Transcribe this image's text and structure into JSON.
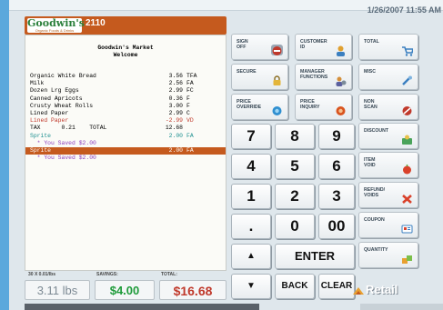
{
  "header": {
    "logo_text": "Goodwin's",
    "logo_sub": "Organic Foods & Drinks",
    "store_number": "2110",
    "datetime": "1/26/2007 11:55 AM"
  },
  "receipt": {
    "store_name": "Goodwin's Market",
    "welcome": "Welcome",
    "lines": [
      {
        "name": "Organic White Bread",
        "amount": "3.56",
        "code": "TFA",
        "style": ""
      },
      {
        "name": "Milk",
        "amount": "2.56",
        "code": "FA",
        "style": ""
      },
      {
        "name": "Dozen Lrg Eggs",
        "amount": "2.99",
        "code": "FC",
        "style": ""
      },
      {
        "name": "Canned Apricots",
        "amount": "0.36",
        "code": "F",
        "style": ""
      },
      {
        "name": "Crusty Wheat Rolls",
        "amount": "3.00",
        "code": "F",
        "style": ""
      },
      {
        "name": "Lined Paper",
        "amount": "2.99",
        "code": "C",
        "style": ""
      },
      {
        "name": "Lined Paper",
        "amount": "-2.99",
        "code": "VD",
        "style": "red"
      },
      {
        "name": "TAX      0.21    TOTAL",
        "amount": "12.68",
        "code": "",
        "style": ""
      },
      {
        "name": "Sprite",
        "amount": "2.00",
        "code": "FA",
        "style": "teal"
      },
      {
        "name": "  * You Saved $2.00",
        "amount": "",
        "code": "",
        "style": "purple"
      },
      {
        "name": "Sprite",
        "amount": "2.00",
        "code": "FA",
        "style": "hl"
      },
      {
        "name": "  * You Saved $2.00",
        "amount": "",
        "code": "",
        "style": "purple"
      }
    ]
  },
  "totals": {
    "weight_label": "30 X 0.01/lbs",
    "weight_value": "3.11 lbs",
    "savings_label": "SAVINGS:",
    "savings_value": "$4.00",
    "total_label": "TOTAL:",
    "total_value": "$16.68"
  },
  "functions": {
    "sign_off": "SIGN\nOFF",
    "customer_id": "CUSTOMER\nID",
    "total": "TOTAL",
    "secure": "SECURE",
    "manager_functions": "MANAGER\nFUNCTIONS",
    "misc": "MISC",
    "price_override": "PRICE\nOVERRIDE",
    "price_inquiry": "PRICE\nINQUIRY",
    "non_scan": "NON\nSCAN",
    "discount": "DISCOUNT",
    "item_void": "ITEM\nVOID",
    "refund_voids": "REFUND/\nVOIDS",
    "coupon": "COUPON",
    "quantity": "QUANTITY"
  },
  "keypad": {
    "k7": "7",
    "k8": "8",
    "k9": "9",
    "k4": "4",
    "k5": "5",
    "k6": "6",
    "k1": "1",
    "k2": "2",
    "k3": "3",
    "kdot": ".",
    "k0": "0",
    "k00": "00",
    "up": "▲",
    "down": "▼",
    "enter": "ENTER",
    "back": "BACK",
    "clear": "CLEAR"
  },
  "brand": {
    "retail": "Retail"
  },
  "colors": {
    "accent": "#c55a1e",
    "savings": "#1f9b3a",
    "total": "#c0392b",
    "background": "#5ba8dc"
  },
  "icons": {
    "sign_off": "no-entry-icon",
    "customer_id": "person-icon",
    "total": "cart-icon",
    "secure": "lock-icon",
    "manager_functions": "manager-icon",
    "misc": "tools-icon",
    "price_override": "price-override-icon",
    "price_inquiry": "price-inquiry-icon",
    "non_scan": "non-scan-icon",
    "discount": "discount-icon",
    "item_void": "apple-icon",
    "refund_voids": "x-icon",
    "coupon": "coupon-icon",
    "quantity": "quantity-icon",
    "retail": "retail-logo-icon"
  }
}
